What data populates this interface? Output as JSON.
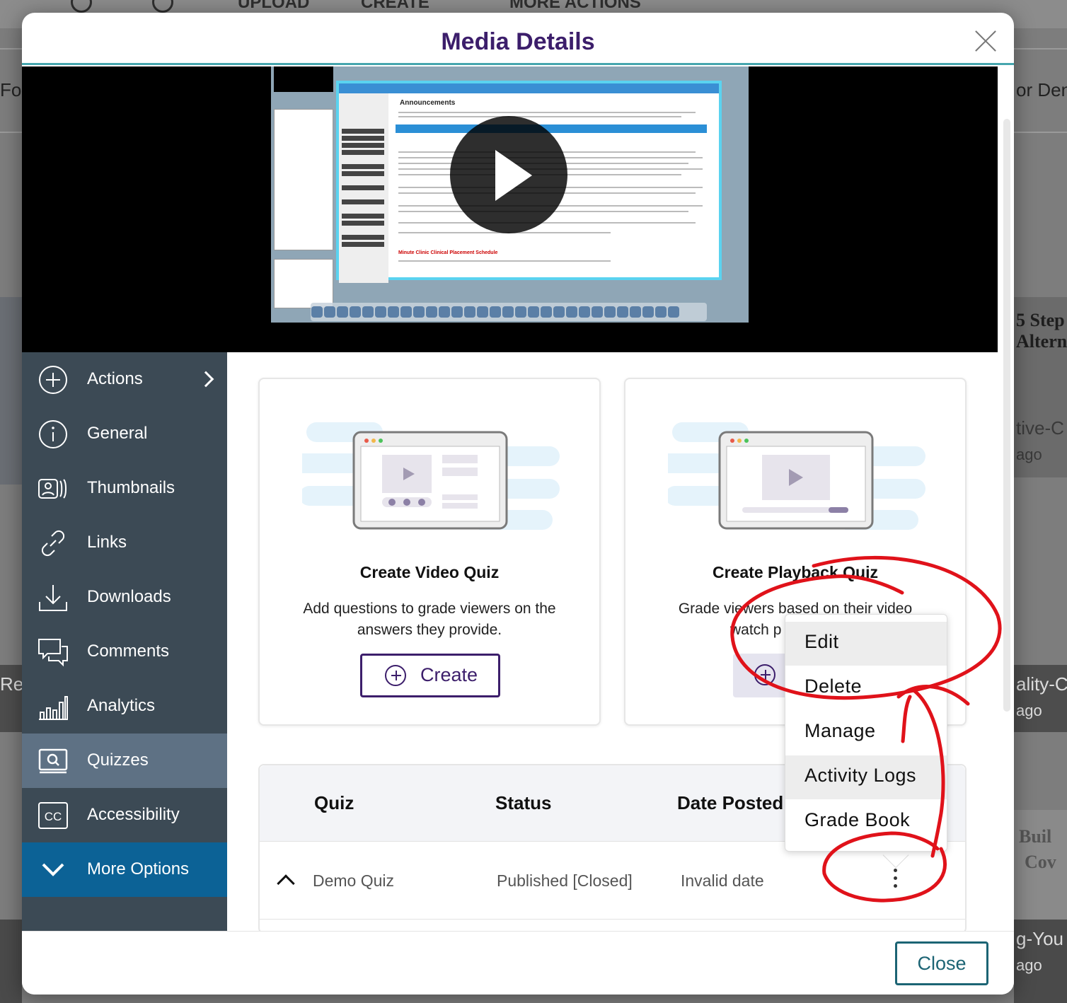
{
  "background": {
    "toolbar": {
      "upload_label": "UPLOAD",
      "create_label": "CREATE",
      "more_actions_label": "MORE ACTIONS"
    },
    "fragments": [
      "Fol",
      "or Den",
      "5 Step",
      "Altern",
      "tive-C",
      "ago",
      "Re",
      "ality-C",
      "ago",
      "Buil",
      "Cov",
      "g-You",
      "ago"
    ]
  },
  "modal": {
    "title": "Media Details",
    "close_label": "Close"
  },
  "video": {
    "preview_heading": "Announcements",
    "preview_footer_title": "Minute Clinic Clinical Placement Schedule"
  },
  "sidebar": {
    "items": [
      {
        "label": "Actions",
        "icon": "plus-circle-icon"
      },
      {
        "label": "General",
        "icon": "info-icon"
      },
      {
        "label": "Thumbnails",
        "icon": "thumbnails-icon"
      },
      {
        "label": "Links",
        "icon": "link-icon"
      },
      {
        "label": "Downloads",
        "icon": "download-icon"
      },
      {
        "label": "Comments",
        "icon": "comments-icon"
      },
      {
        "label": "Analytics",
        "icon": "analytics-icon"
      },
      {
        "label": "Quizzes",
        "icon": "quiz-icon"
      },
      {
        "label": "Accessibility",
        "icon": "cc-icon"
      },
      {
        "label": "More Options",
        "icon": "chevron-down-icon"
      }
    ],
    "active": "Quizzes"
  },
  "cards": {
    "video_quiz": {
      "title": "Create Video Quiz",
      "description": "Add questions to grade viewers on the answers they provide.",
      "button": "Create"
    },
    "playback_quiz": {
      "title": "Create Playback Quiz",
      "description_line1": "Grade viewers based on their video",
      "description_line2": "watch p"
    }
  },
  "table": {
    "headers": {
      "quiz": "Quiz",
      "status": "Status",
      "date": "Date Posted"
    },
    "rows": [
      {
        "quiz": "Demo Quiz",
        "status": "Published [Closed]",
        "date": "Invalid date"
      }
    ]
  },
  "menu": {
    "items": [
      "Edit",
      "Delete",
      "Manage",
      "Activity Logs",
      "Grade Book"
    ]
  },
  "colors": {
    "title": "#3c1e6b",
    "sidebar_bg": "#3c4a55",
    "sidebar_active": "#5e7184",
    "sidebar_more": "#0c6296",
    "annotation": "#e0121a"
  }
}
